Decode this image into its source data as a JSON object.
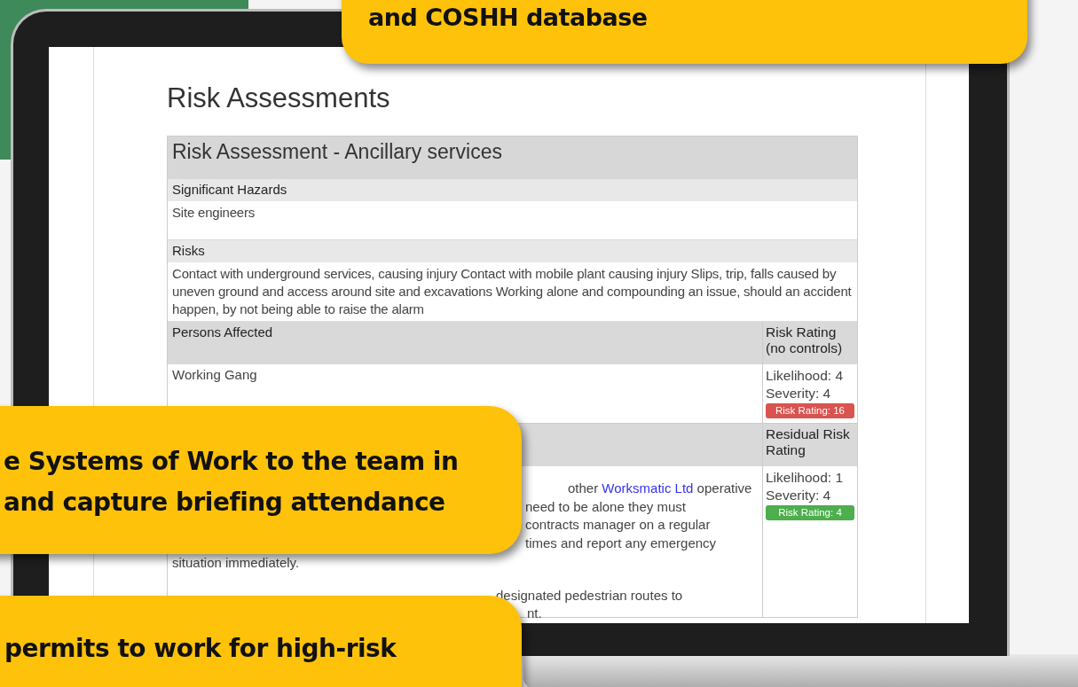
{
  "page": {
    "title": "Risk Assessments"
  },
  "assessment": {
    "title": "Risk Assessment - Ancillary services",
    "sections": [
      {
        "heading": "Significant Hazards",
        "body": "Site engineers"
      },
      {
        "heading": "Risks",
        "body": "Contact with underground services, causing injury Contact with mobile plant causing injury Slips, trip, falls caused by uneven ground and access around site and excavations Working alone and compounding an issue, should an accident happen, by not being able to raise the alarm"
      }
    ],
    "persons_affected": {
      "heading": "Persons Affected",
      "rating_heading": "Risk Rating (no controls)",
      "body": "Working Gang",
      "likelihood": "Likelihood: 4",
      "severity": "Severity: 4",
      "rating": "Risk Rating: 16",
      "color": "#d9534f"
    },
    "controls": {
      "rating_heading": "Residual Risk Rating",
      "lines": [
        {
          "before": "other ",
          "link": "Worksmatic Ltd",
          "after": " operative"
        },
        {
          "before": "need to be alone they must"
        },
        {
          "before": "contracts manager on a regular"
        },
        {
          "before": "times and report any emergency"
        },
        {
          "before": "situation immediately."
        },
        {
          "before": "designated pedestrian routes to"
        },
        {
          "before": "nt."
        }
      ],
      "likelihood": "Likelihood: 1",
      "severity": "Severity: 4",
      "rating": "Risk Rating: 4",
      "color": "#4cae4c"
    }
  },
  "callouts": [
    {
      "lines": [
        "and COSHH database"
      ]
    },
    {
      "lines": [
        "e Systems of Work to the team in",
        "and capture briefing attendance"
      ]
    },
    {
      "lines": [
        "permits to work for high-risk"
      ]
    }
  ]
}
